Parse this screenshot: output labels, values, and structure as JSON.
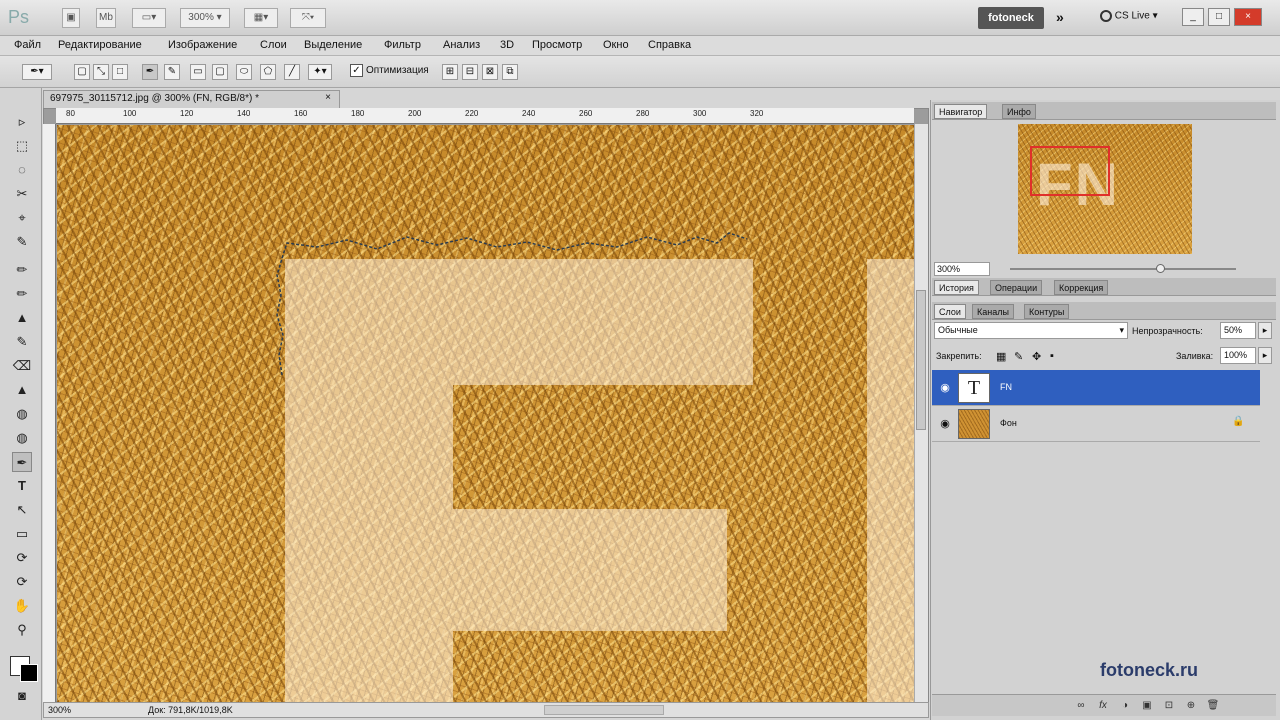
{
  "app": {
    "logo": "Ps",
    "zoom_select": "300%",
    "workspace": "fotoneck",
    "more": "»",
    "cs_live": "CS Live ▾",
    "win_min": "_",
    "win_max": "□",
    "win_close": "×"
  },
  "menu": [
    "Файл",
    "Редактирование",
    "Изображение",
    "Слои",
    "Выделение",
    "Фильтр",
    "Анализ",
    "3D",
    "Просмотр",
    "Окно",
    "Справка"
  ],
  "options": {
    "checkbox_mark": "✓",
    "checkbox_label": "Оптимизация"
  },
  "document": {
    "tab_title": "697975_30115712.jpg @ 300% (FN, RGB/8*) *",
    "tab_close": "×",
    "ruler_labels": [
      "80",
      "100",
      "120",
      "140",
      "160",
      "180",
      "200",
      "220",
      "240",
      "260",
      "280",
      "300",
      "320"
    ],
    "status_zoom": "300%",
    "status_doc": "Док: 791,8K/1019,8K"
  },
  "tools": [
    "▹",
    "⬚",
    "◌",
    "✂",
    "⌖",
    "✎",
    "✏",
    "⌫",
    "▲",
    "◍",
    "✒",
    "T",
    "↖",
    "▭",
    "⟳",
    "✋",
    "⚲"
  ],
  "navigator": {
    "tabs": [
      "Навигатор",
      "Инфо"
    ],
    "zoom": "300%",
    "thumb_text": "FN"
  },
  "history_tabs": [
    "История",
    "Операции",
    "Коррекция"
  ],
  "layers_panel": {
    "tabs": [
      "Слои",
      "Каналы",
      "Контуры"
    ],
    "blend_mode": "Обычные",
    "opacity_label": "Непрозрачность:",
    "opacity_value": "50%",
    "lock_label": "Закрепить:",
    "fill_label": "Заливка:",
    "fill_value": "100%",
    "layers": [
      {
        "name": "FN",
        "thumb": "T",
        "selected": true
      },
      {
        "name": "Фон",
        "thumb": "",
        "selected": false
      }
    ],
    "lock_icon": "🔒"
  },
  "watermark": "fotoneck.ru",
  "eye_glyph": "◉",
  "bottom_icons": [
    "∞",
    "fx",
    "◑",
    "▣",
    "⊡",
    "⊕",
    "🗑"
  ]
}
